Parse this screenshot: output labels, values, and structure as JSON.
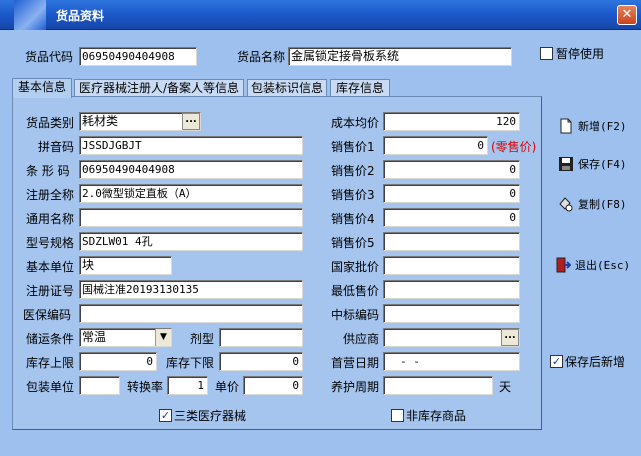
{
  "window": {
    "title": "货品资料",
    "close_glyph": "✕"
  },
  "header": {
    "code_label": "货品代码",
    "code_value": "06950490404908",
    "name_label": "货品名称",
    "name_value": "金属锁定接骨板系统",
    "suspend_label": "暂停使用",
    "suspend_checked": false
  },
  "tabs": [
    {
      "label": "基本信息"
    },
    {
      "label": "医疗器械注册人/备案人等信息"
    },
    {
      "label": "包装标识信息"
    },
    {
      "label": "库存信息"
    }
  ],
  "left": {
    "category_label": "货品类别",
    "category_value": "耗材类",
    "ellipsis": "...",
    "pinyin_label": "拼音码",
    "pinyin_value": "JSSDJGBJT",
    "barcode_label": "条 形 码",
    "barcode_value": "06950490404908",
    "regname_label": "注册全称",
    "regname_value": "2.0微型锁定直板（A）",
    "common_label": "通用名称",
    "common_value": "",
    "model_label": "型号规格",
    "model_value": "SDZLW01 4孔",
    "unit_label": "基本单位",
    "unit_value": "块",
    "regno_label": "注册证号",
    "regno_value": "国械注准20193130135",
    "insurance_label": "医保编码",
    "insurance_value": "",
    "storage_label": "储运条件",
    "storage_value": "常温",
    "dosage_label": "剂型",
    "dosage_value": "",
    "stockmax_label": "库存上限",
    "stockmax_value": "0",
    "stockmin_label": "库存下限",
    "stockmin_value": "0",
    "packunit_label": "包装单位",
    "packunit_value": "",
    "rate_label": "转换率",
    "rate_value": "1",
    "unitprice_label": "单价",
    "unitprice_value": "0",
    "class3_label": "三类医疗器械",
    "class3_checked": true
  },
  "right": {
    "cost_label": "成本均价",
    "cost_value": "120",
    "price1_label": "销售价1",
    "price1_value": "0",
    "retail_note": "(零售价)",
    "price2_label": "销售价2",
    "price2_value": "0",
    "price3_label": "销售价3",
    "price3_value": "0",
    "price4_label": "销售价4",
    "price4_value": "0",
    "price5_label": "销售价5",
    "price5_value": "",
    "national_label": "国家批价",
    "national_value": "",
    "lowest_label": "最低售价",
    "lowest_value": "",
    "bid_label": "中标编码",
    "bid_value": "",
    "supplier_label": "供应商",
    "supplier_value": "",
    "firstdate_label": "首营日期",
    "firstdate_value": "-   -",
    "maint_label": "养护周期",
    "maint_value": "",
    "maint_unit": "天",
    "nonstock_label": "非库存商品",
    "nonstock_checked": false
  },
  "side": {
    "new_label": "新增(F2)",
    "save_label": "保存(F4)",
    "copy_label": "复制(F8)",
    "exit_label": "退出(Esc)",
    "save_new_label": "保存后新增",
    "save_new_checked": true
  },
  "colors": {
    "retail_note": "#e00000",
    "title_bar": "#1a56c8",
    "panel": "#a5c4ee"
  }
}
